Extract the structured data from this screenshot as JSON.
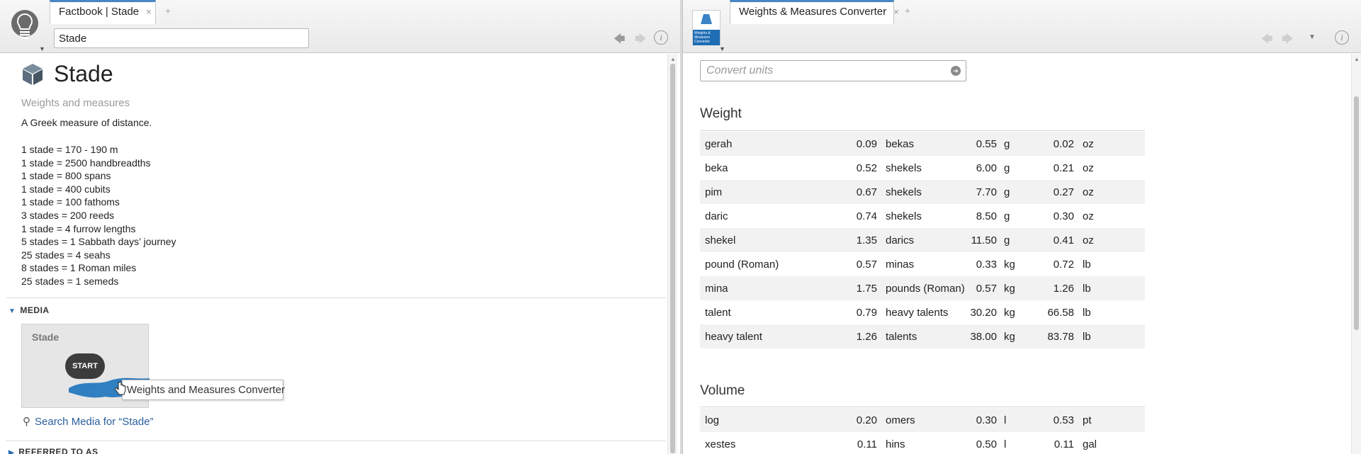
{
  "left": {
    "tab": {
      "label": "Factbook | Stade",
      "close": "×",
      "new_tab": "+"
    },
    "address": "Stade",
    "nav": {
      "back": "🡄",
      "forward": "🡆",
      "info": "i"
    },
    "article": {
      "title": "Stade",
      "subtitle": "Weights and measures",
      "description": "A Greek measure of distance.",
      "facts": [
        "1 stade = 170 - 190 m",
        "1 stade = 2500 handbreadths",
        "1 stade = 800 spans",
        "1 stade = 400 cubits",
        "1 stade = 100 fathoms",
        "3 stades = 200 reeds",
        "1 stade = 4 furrow lengths",
        "5 stades = 1 Sabbath days’ journey",
        "25 stades = 4 seahs",
        "8 stades = 1 Roman miles",
        "25 stades = 1 semeds"
      ]
    },
    "media": {
      "heading": "MEDIA",
      "caret": "▼",
      "thumb_label": "Stade",
      "start_label": "START",
      "tooltip": "Weights and Measures Converter",
      "search_link": "Search Media for “Stade”"
    },
    "referred": {
      "heading": "REFERRED TO AS",
      "caret": "▶"
    }
  },
  "right": {
    "tab": {
      "label": "Weights & Measures Converter",
      "close": "×",
      "new_tab": "+"
    },
    "app_icon_text": "Weights & Measures Converter",
    "nav": {
      "back": "🡄",
      "forward": "🡆",
      "menu": "▼",
      "info": "i"
    },
    "convert_placeholder": "Convert units",
    "go": "➔",
    "weight": {
      "title": "Weight",
      "rows": [
        [
          "gerah",
          "0.09",
          "bekas",
          "0.55",
          "g",
          "0.02",
          "oz"
        ],
        [
          "beka",
          "0.52",
          "shekels",
          "6.00",
          "g",
          "0.21",
          "oz"
        ],
        [
          "pim",
          "0.67",
          "shekels",
          "7.70",
          "g",
          "0.27",
          "oz"
        ],
        [
          "daric",
          "0.74",
          "shekels",
          "8.50",
          "g",
          "0.30",
          "oz"
        ],
        [
          "shekel",
          "1.35",
          "darics",
          "11.50",
          "g",
          "0.41",
          "oz"
        ],
        [
          "pound (Roman)",
          "0.57",
          "minas",
          "0.33",
          "kg",
          "0.72",
          "lb"
        ],
        [
          "mina",
          "1.75",
          "pounds (Roman)",
          "0.57",
          "kg",
          "1.26",
          "lb"
        ],
        [
          "talent",
          "0.79",
          "heavy talents",
          "30.20",
          "kg",
          "66.58",
          "lb"
        ],
        [
          "heavy talent",
          "1.26",
          "talents",
          "38.00",
          "kg",
          "83.78",
          "lb"
        ]
      ]
    },
    "volume": {
      "title": "Volume",
      "rows": [
        [
          "log",
          "0.20",
          "omers",
          "0.30",
          "l",
          "0.53",
          "pt"
        ],
        [
          "xestes",
          "0.11",
          "hins",
          "0.50",
          "l",
          "0.11",
          "gal"
        ]
      ]
    }
  }
}
